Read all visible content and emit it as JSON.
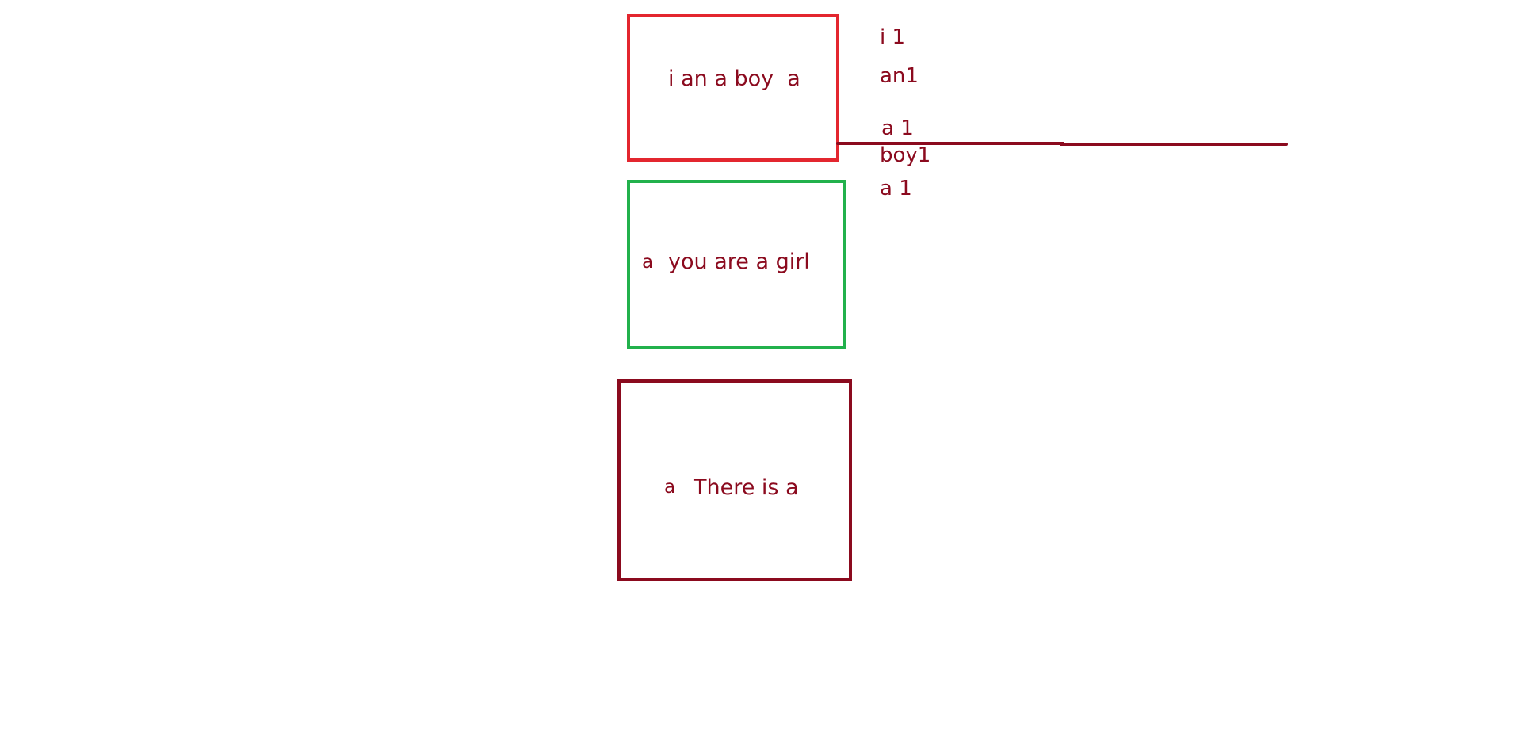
{
  "colors": {
    "ink": "#8B0A1E",
    "box_red": "#E3262F",
    "box_green": "#22B14C",
    "box_darkred": "#8B0A1E",
    "background": "#FFFFFF"
  },
  "boxes": [
    {
      "text": "i an a boy  a",
      "color": "box_red"
    },
    {
      "side": "a",
      "text": "you are a girl",
      "color": "box_green"
    },
    {
      "side": "a",
      "text": "There is a",
      "color": "box_darkred"
    }
  ],
  "word_counts": [
    "i 1",
    "an1",
    "a 1",
    "boy1",
    "a 1"
  ]
}
